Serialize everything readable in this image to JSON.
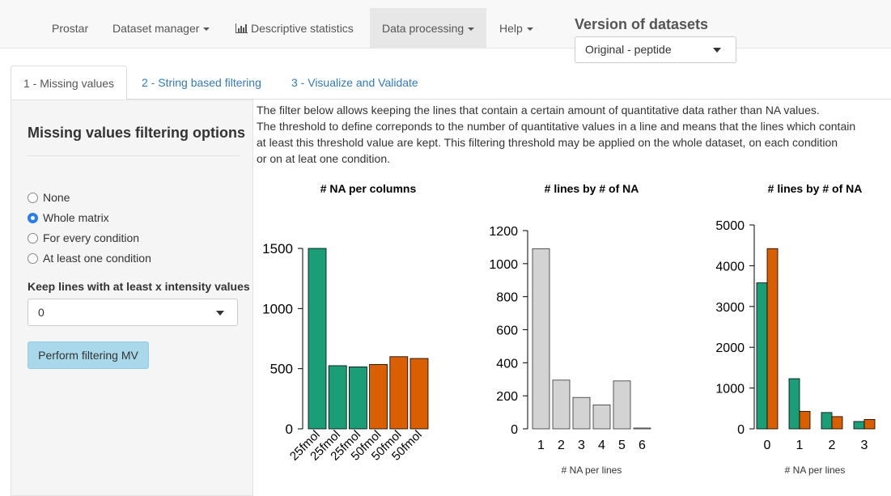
{
  "navbar": {
    "items": [
      {
        "label": "Prostar",
        "has_caret": false
      },
      {
        "label": "Dataset manager",
        "has_caret": true
      },
      {
        "label": "Descriptive statistics",
        "has_caret": false,
        "icon": "bar-chart-icon"
      },
      {
        "label": "Data processing",
        "has_caret": true,
        "active": true
      },
      {
        "label": "Help",
        "has_caret": true
      }
    ],
    "version_title": "Version of datasets",
    "version_value": "Original - peptide"
  },
  "tabs": [
    {
      "label": "1 - Missing values",
      "active": true
    },
    {
      "label": "2 - String based filtering"
    },
    {
      "label": "3 - Visualize and Validate"
    }
  ],
  "sidebar": {
    "title": "Missing values filtering options",
    "options": [
      {
        "label": "None",
        "checked": false
      },
      {
        "label": "Whole matrix",
        "checked": true
      },
      {
        "label": "For every condition",
        "checked": false
      },
      {
        "label": "At least one condition",
        "checked": false
      }
    ],
    "keep_label": "Keep lines with at least x intensity values",
    "keep_value": "0",
    "perform_button": "Perform filtering MV"
  },
  "description": [
    "The filter below allows keeping the lines that contain a certain amount of quantitative data rather than NA values.",
    "The threshold to define correponds to the number of quantitative values in a line and means that the lines which contain",
    "at least this threshold value are kept. This filtering threshold may be applied on the whole dataset, on each condition",
    "or on at leat one condition."
  ],
  "colors": {
    "green": "#1b9e77",
    "orange": "#d95f02",
    "grey": "#d3d3d3",
    "accent": "#2b7de9"
  },
  "chart_data": [
    {
      "type": "bar",
      "title": "# NA per columns",
      "categories": [
        "25fmol",
        "25fmol",
        "25fmol",
        "50fmol",
        "50fmol",
        "50fmol"
      ],
      "values": [
        1500,
        525,
        515,
        535,
        600,
        585
      ],
      "bar_colors": [
        "#1b9e77",
        "#1b9e77",
        "#1b9e77",
        "#d95f02",
        "#d95f02",
        "#d95f02"
      ],
      "yticks": [
        0,
        500,
        1000,
        1500
      ],
      "ylim": [
        0,
        1600
      ],
      "xlabel": ""
    },
    {
      "type": "bar",
      "title": "# lines by # of NA",
      "categories": [
        "1",
        "2",
        "3",
        "4",
        "5",
        "6"
      ],
      "values": [
        1090,
        295,
        190,
        145,
        290,
        5
      ],
      "bar_colors": [
        "#d3d3d3",
        "#d3d3d3",
        "#d3d3d3",
        "#d3d3d3",
        "#d3d3d3",
        "#d3d3d3"
      ],
      "yticks": [
        0,
        200,
        400,
        600,
        800,
        1000,
        1200
      ],
      "ylim": [
        0,
        1200
      ],
      "xlabel": "# NA per lines"
    },
    {
      "type": "bar",
      "title": "# lines by # of NA",
      "categories": [
        "0",
        "1",
        "2",
        "3"
      ],
      "series": [
        {
          "values": [
            3580,
            1230,
            400,
            180
          ],
          "color": "#1b9e77"
        },
        {
          "values": [
            4420,
            430,
            300,
            230
          ],
          "color": "#d95f02"
        }
      ],
      "yticks": [
        0,
        1000,
        2000,
        3000,
        4000,
        5000
      ],
      "ylim": [
        0,
        5000
      ],
      "xlabel": "# NA per lines"
    }
  ]
}
